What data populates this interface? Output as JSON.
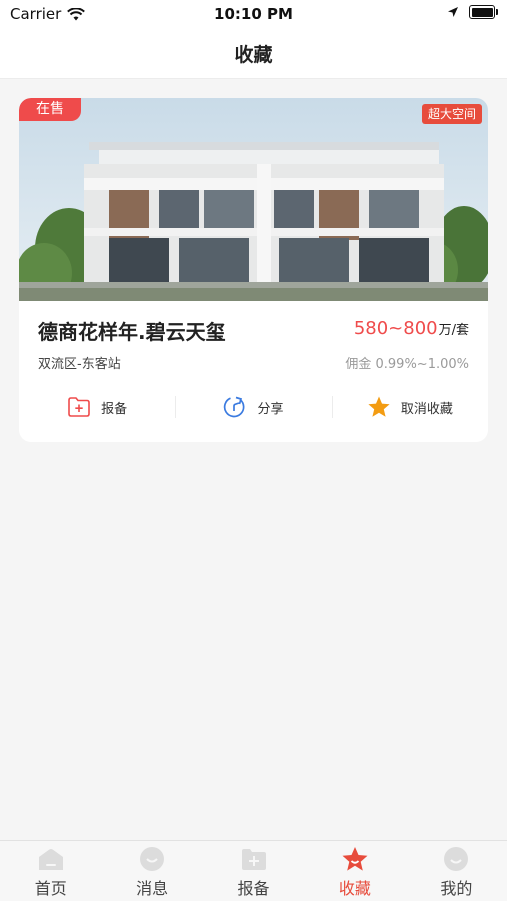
{
  "status_bar": {
    "carrier": "Carrier",
    "time": "10:10 PM"
  },
  "nav": {
    "title": "收藏"
  },
  "favorite": {
    "sale_badge": "在售",
    "feature_tag": "超大空间",
    "name": "德商花样年.碧云天玺",
    "price_value": "580~800",
    "price_unit": "万/套",
    "location": "双流区-东客站",
    "commission": "佣金 0.99%~1.00%",
    "actions": {
      "report": "报备",
      "share": "分享",
      "unfavorite": "取消收藏"
    }
  },
  "tabbar": {
    "items": [
      {
        "label": "首页",
        "icon": "home-icon"
      },
      {
        "label": "消息",
        "icon": "message-icon"
      },
      {
        "label": "报备",
        "icon": "report-icon"
      },
      {
        "label": "收藏",
        "icon": "star-icon",
        "active": true
      },
      {
        "label": "我的",
        "icon": "profile-icon"
      }
    ]
  },
  "colors": {
    "accent": "#ef4b4b",
    "star": "#f39c12",
    "share_blue": "#3b7be0"
  }
}
